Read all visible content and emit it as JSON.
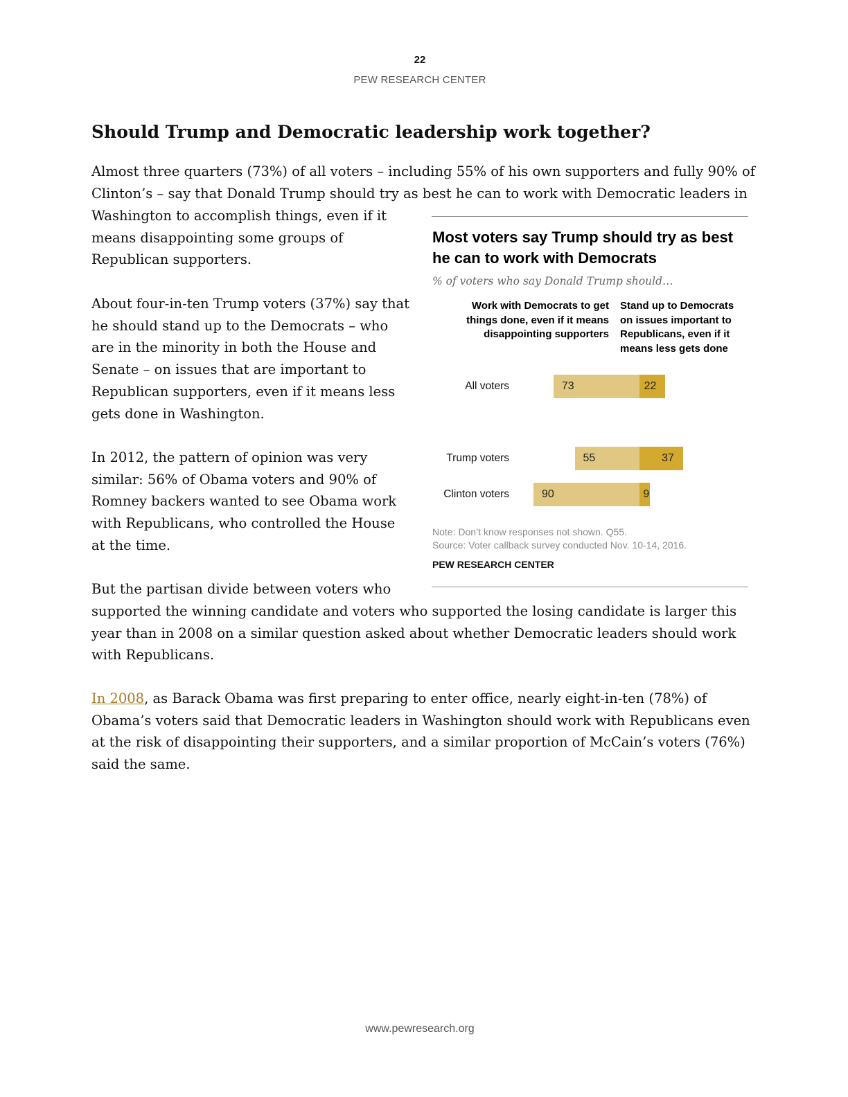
{
  "header": {
    "page_number": "22",
    "org": "PEW RESEARCH CENTER"
  },
  "heading": "Should Trump and Democratic leadership work together?",
  "paragraphs": {
    "p1_full": "Almost three quarters (73%) of all voters – including 55% of his own supporters and fully 90% of Clinton’s – say that Donald Trump should try as best he can to work with Democratic leaders in",
    "p1_wrap": "Washington to accomplish things, even if it means disappointing some groups of Republican supporters.",
    "p2": "About four-in-ten Trump voters (37%) say that he should stand up to the Democrats – who are in the minority in both the House and Senate – on issues that are important to Republican supporters, even if it means less gets done in Washington.",
    "p3": "In 2012, the pattern of opinion was very similar: 56% of Obama voters and 90% of Romney backers wanted to see Obama work with Republicans, who controlled the House at the time.",
    "p4_start": "But the partisan divide between voters who",
    "p4_full": "supported the winning candidate and voters who supported the losing candidate is larger this year than in 2008 on a similar question asked about whether Democratic leaders should work with Republicans.",
    "p5_link": "In 2008",
    "p5_rest": ", as Barack Obama was first preparing to enter office, nearly eight-in-ten (78%) of Obama’s voters said that Democratic leaders in Washington should work with Republicans even at the risk of disappointing their supporters, and a similar proportion of McCain’s voters (76%) said the same."
  },
  "chart_data": {
    "type": "bar",
    "orientation": "horizontal",
    "stacked": "diverging",
    "title": "Most voters say Trump should try as best he can to work with Democrats",
    "subtitle": "% of voters who say Donald Trump should…",
    "categories": [
      "All voters",
      "Trump voters",
      "Clinton voters"
    ],
    "series": [
      {
        "name": "Work with Democrats to get things done, even if it means disappointing supporters",
        "values": [
          73,
          55,
          90
        ],
        "color": "#e0c882"
      },
      {
        "name": "Stand up to Democrats on issues important to Republicans, even if it means less gets done",
        "values": [
          22,
          37,
          9
        ],
        "color": "#d4a92f"
      }
    ],
    "note": "Note: Don’t know responses not shown. Q55.",
    "source": "Source: Voter callback survey conducted Nov. 10-14, 2016.",
    "credit": "PEW RESEARCH CENTER"
  },
  "footer": "www.pewresearch.org"
}
